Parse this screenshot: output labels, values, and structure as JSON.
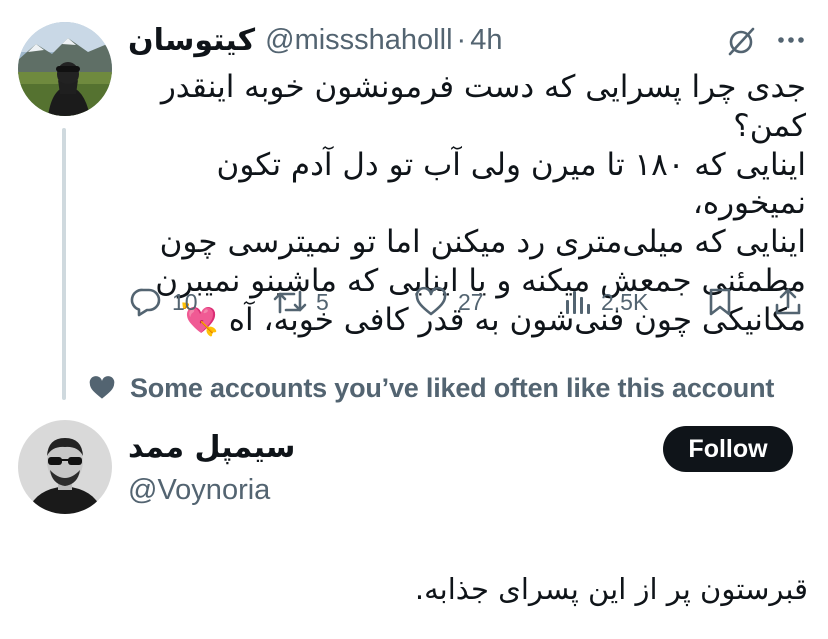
{
  "tweet": {
    "author_name": "کیتوسان",
    "author_handle": "@missshaholll",
    "separator": "·",
    "time": "4h",
    "icons": {
      "grok": "grok-icon",
      "more": "more-dots-icon"
    },
    "text": "جدی چرا پسرایی که دست فرمونشون خوبه اینقدر کمن؟\nاینایی که ۱۸۰ تا میرن ولی آب تو دل آدم تکون نمیخوره،\nاینایی که میلی‌متری رد میکنن اما تو نمیترسی چون\nمطمئنی جمعش میکنه و یا اینایی که ماشینو نمیبرن\nمکانیکی چون  فنی‌شون به قدر کافی خوبه، آه 💘",
    "actions": {
      "replies": "10",
      "retweets": "5",
      "likes": "27",
      "views": "2.5K"
    }
  },
  "social_context": {
    "icon": "heart-icon",
    "text": "Some accounts you’ve liked often like this account"
  },
  "suggested_user": {
    "name": "سیمپل ممد",
    "handle": "@Voynoria",
    "follow_label": "Follow",
    "bio": "قبرستون پر از این پسرای جذابه."
  },
  "colors": {
    "text": "#0f1419",
    "secondary": "#536471",
    "thread_line": "#cfd9de",
    "follow_bg": "#0f1419"
  }
}
